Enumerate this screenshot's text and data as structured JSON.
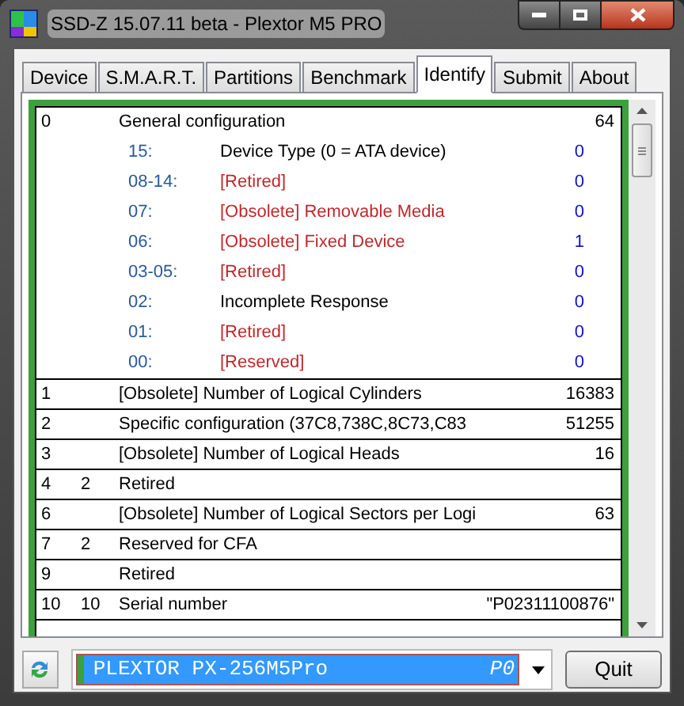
{
  "window": {
    "title": "SSD-Z 15.07.11 beta - Plextor M5 PRO"
  },
  "tabs": [
    {
      "label": "Device",
      "selected": false
    },
    {
      "label": "S.M.A.R.T.",
      "selected": false
    },
    {
      "label": "Partitions",
      "selected": false
    },
    {
      "label": "Benchmark",
      "selected": false
    },
    {
      "label": "Identify",
      "selected": true
    },
    {
      "label": "Submit",
      "selected": false
    },
    {
      "label": "About",
      "selected": false
    }
  ],
  "identify_rows": [
    {
      "index": "0",
      "description": "General configuration",
      "value": "64",
      "children": [
        {
          "bits": "15:",
          "description": "Device Type (0 = ATA device)",
          "value": "0",
          "kind": "normal"
        },
        {
          "bits": "08-14:",
          "description": "[Retired]",
          "value": "0",
          "kind": "retired"
        },
        {
          "bits": "07:",
          "description": "[Obsolete] Removable Media",
          "value": "0",
          "kind": "retired"
        },
        {
          "bits": "06:",
          "description": "[Obsolete] Fixed Device",
          "value": "1",
          "kind": "retired"
        },
        {
          "bits": "03-05:",
          "description": "[Retired]",
          "value": "0",
          "kind": "retired"
        },
        {
          "bits": "02:",
          "description": "Incomplete Response",
          "value": "0",
          "kind": "normal"
        },
        {
          "bits": "01:",
          "description": "[Retired]",
          "value": "0",
          "kind": "retired"
        },
        {
          "bits": "00:",
          "description": "[Reserved]",
          "value": "0",
          "kind": "retired"
        }
      ]
    },
    {
      "index": "1",
      "description": "[Obsolete] Number of Logical Cylinders",
      "value": "16383"
    },
    {
      "index": "2",
      "description": "Specific configuration (37C8,738C,8C73,C83",
      "value": "51255"
    },
    {
      "index": "3",
      "description": "[Obsolete] Number of Logical Heads",
      "value": "16"
    },
    {
      "index": "4",
      "count": "2",
      "description": "Retired"
    },
    {
      "index": "6",
      "description": "[Obsolete] Number of Logical Sectors per Logi",
      "value": "63"
    },
    {
      "index": "7",
      "count": "2",
      "description": "Reserved for CFA"
    },
    {
      "index": "9",
      "description": "Retired"
    },
    {
      "index": "10",
      "count": "10",
      "description": "Serial number",
      "value": "\"P02311100876\""
    }
  ],
  "drive_select": {
    "value": "PLEXTOR PX-256M5Pro",
    "suffix": "P0"
  },
  "buttons": [
    {
      "label": "Quit"
    }
  ]
}
